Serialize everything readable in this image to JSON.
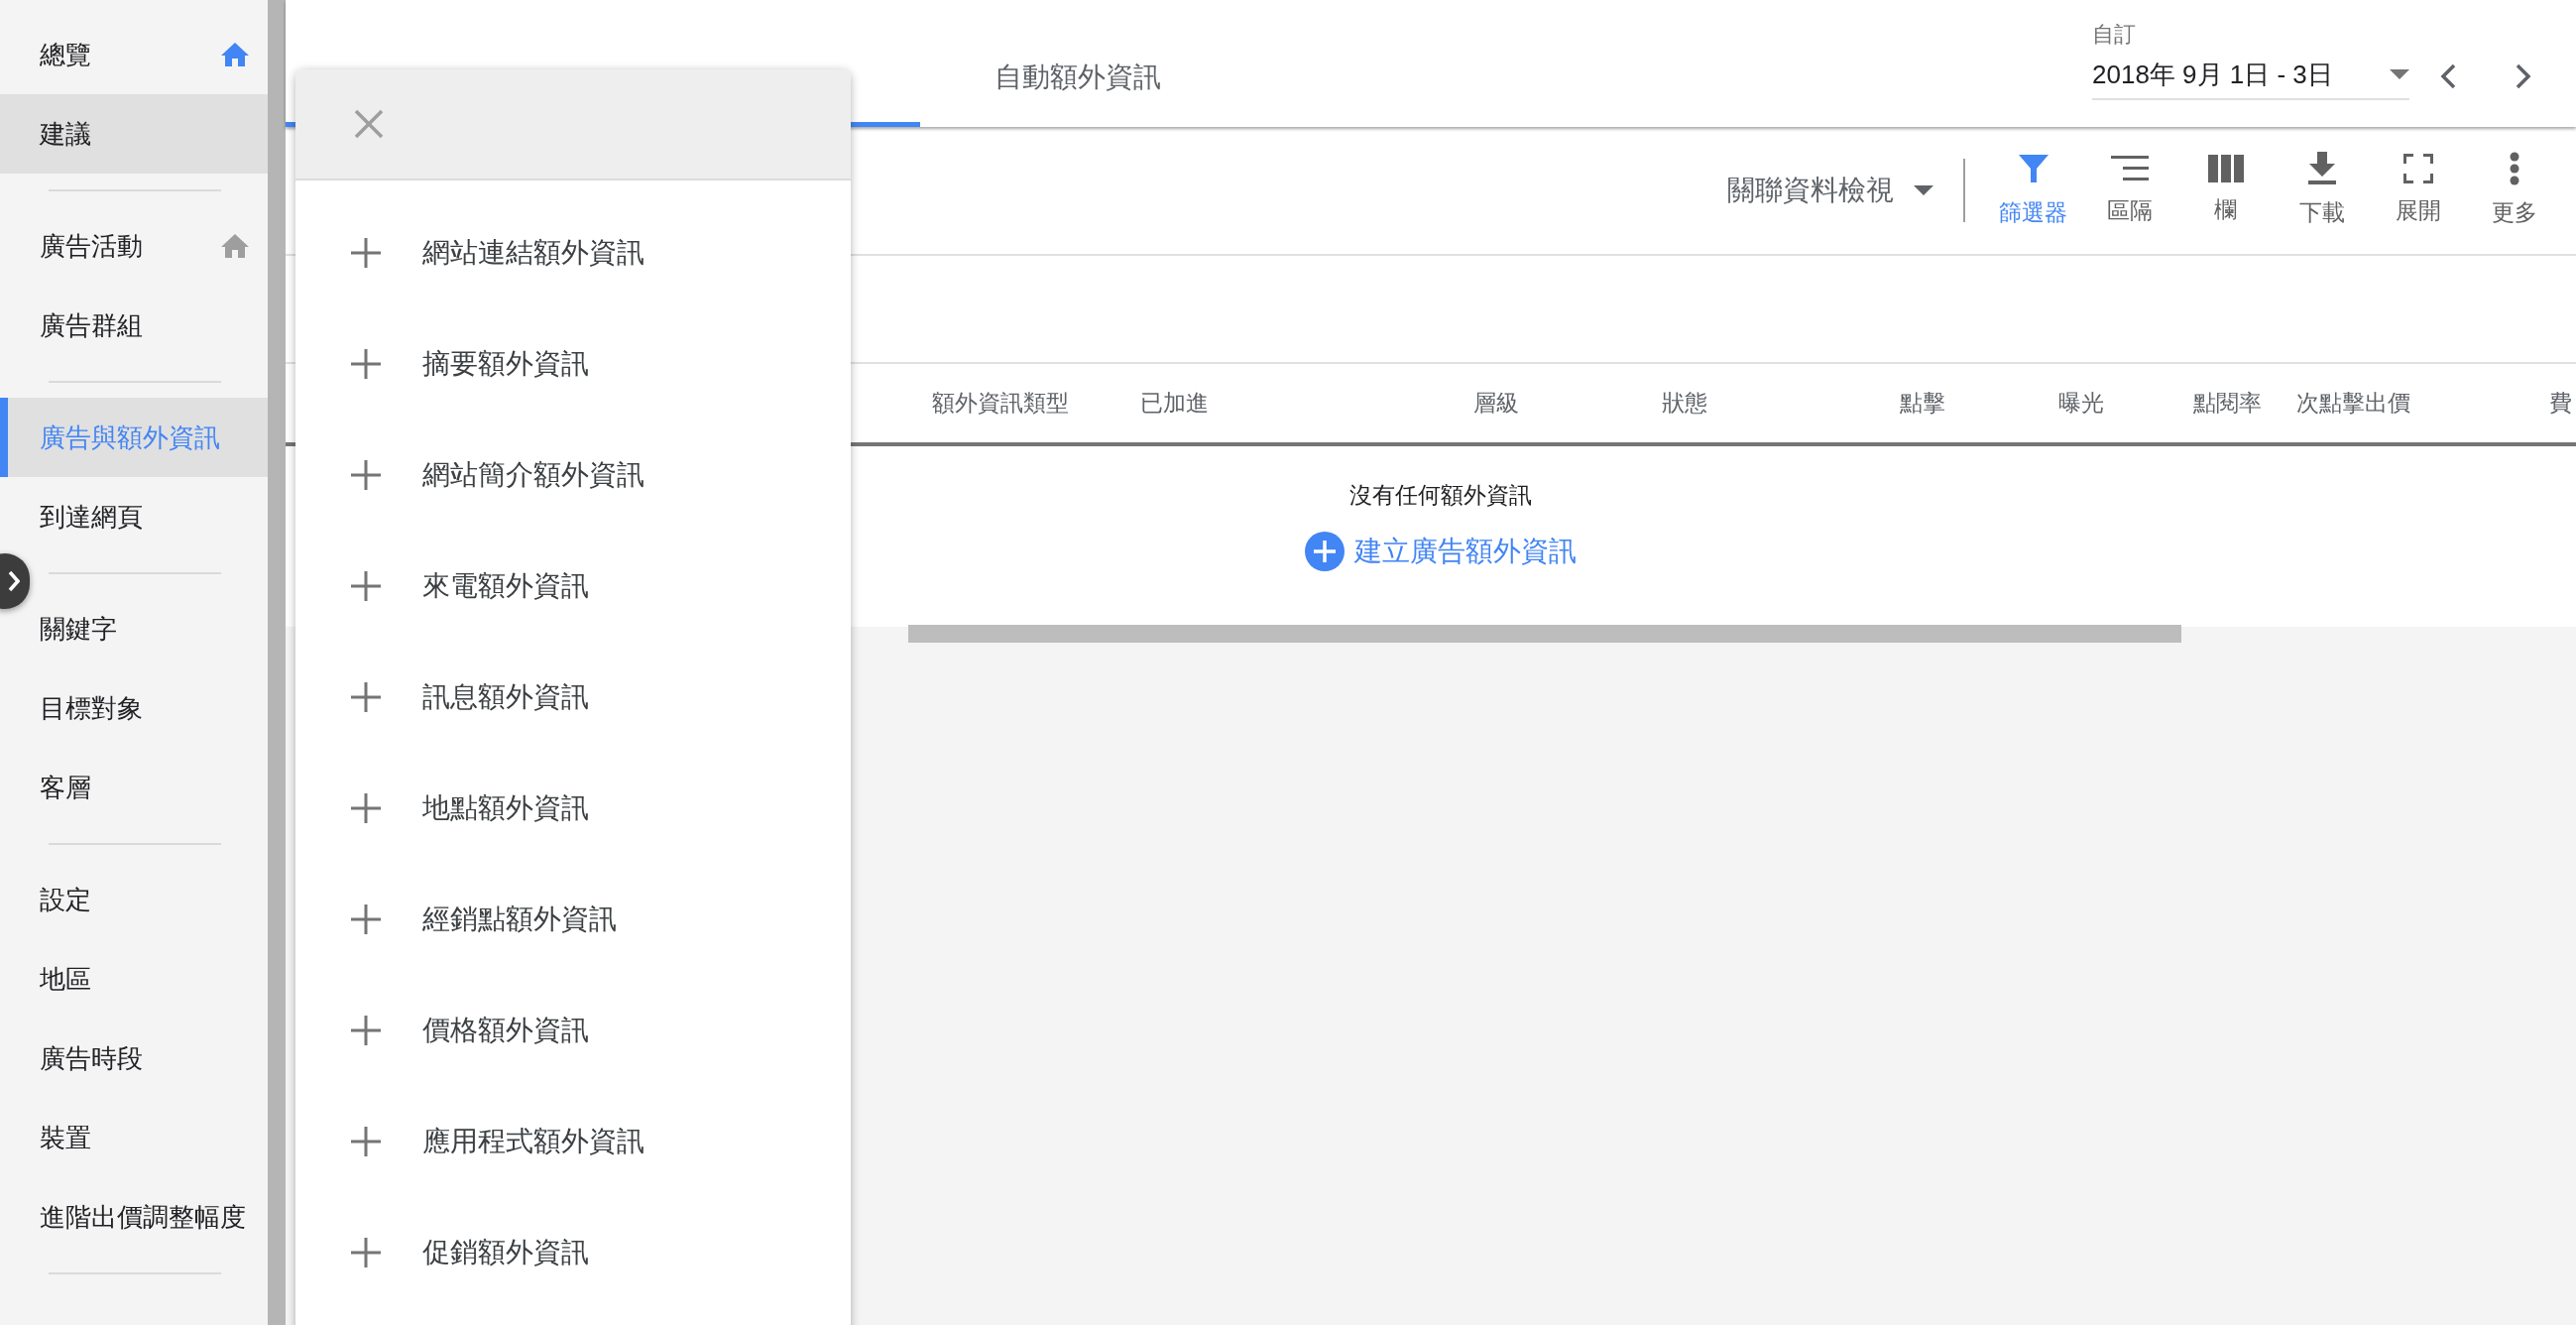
{
  "sidebar": {
    "groups": [
      [
        {
          "label": "總覽",
          "selected": false,
          "highlighted": false,
          "home_icon": {
            "active": true
          }
        },
        {
          "label": "建議",
          "selected": false,
          "highlighted": true
        }
      ],
      [
        {
          "label": "廣告活動",
          "selected": false,
          "highlighted": false,
          "home_icon": {
            "active": false
          }
        },
        {
          "label": "廣告群組",
          "selected": false,
          "highlighted": false
        }
      ],
      [
        {
          "label": "廣告與額外資訊",
          "selected": true,
          "highlighted": true
        },
        {
          "label": "到達網頁",
          "selected": false,
          "highlighted": false
        }
      ],
      [
        {
          "label": "關鍵字",
          "selected": false,
          "highlighted": false
        },
        {
          "label": "目標對象",
          "selected": false,
          "highlighted": false
        },
        {
          "label": "客層",
          "selected": false,
          "highlighted": false
        }
      ],
      [
        {
          "label": "設定",
          "selected": false,
          "highlighted": false
        },
        {
          "label": "地區",
          "selected": false,
          "highlighted": false
        },
        {
          "label": "廣告時段",
          "selected": false,
          "highlighted": false
        },
        {
          "label": "裝置",
          "selected": false,
          "highlighted": false
        },
        {
          "label": "進階出價調整幅度",
          "selected": false,
          "highlighted": false
        }
      ]
    ]
  },
  "tabs": [
    {
      "label": "自動額外資訊",
      "selected": false
    }
  ],
  "date_range": {
    "label": "自訂",
    "value": "2018年 9月 1日 - 3日"
  },
  "toolbar": {
    "view_selector": "關聯資料檢視",
    "tools": [
      {
        "kind": "filter",
        "label": "篩選器",
        "selected": true
      },
      {
        "kind": "segment",
        "label": "區隔",
        "selected": false
      },
      {
        "kind": "columns",
        "label": "欄",
        "selected": false
      },
      {
        "kind": "download",
        "label": "下載",
        "selected": false
      },
      {
        "kind": "expand",
        "label": "展開",
        "selected": false
      },
      {
        "kind": "more",
        "label": "更多",
        "selected": false
      }
    ]
  },
  "table": {
    "columns": [
      "額外資訊類型",
      "已加進",
      "層級",
      "狀態",
      "點擊",
      "曝光",
      "點閱率",
      "次點擊出價",
      "費"
    ],
    "empty_message": "沒有任何額外資訊",
    "create_link": "建立廣告額外資訊"
  },
  "add_menu": {
    "items": [
      "網站連結額外資訊",
      "摘要額外資訊",
      "網站簡介額外資訊",
      "來電額外資訊",
      "訊息額外資訊",
      "地點額外資訊",
      "經銷點額外資訊",
      "價格額外資訊",
      "應用程式額外資訊",
      "促銷額外資訊"
    ]
  }
}
